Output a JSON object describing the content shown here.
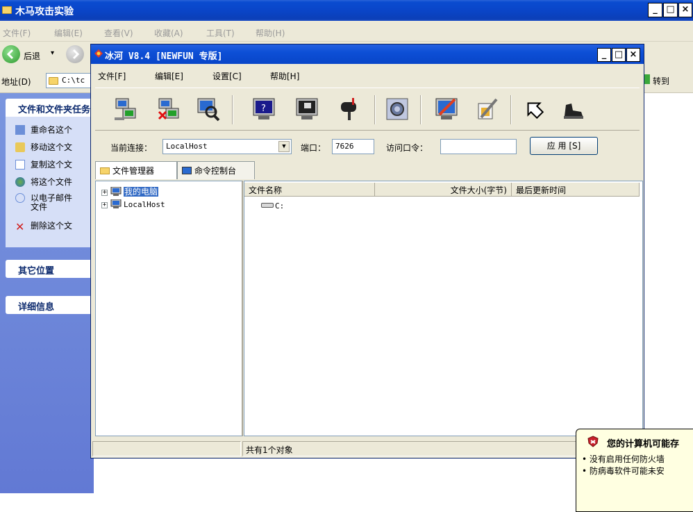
{
  "explorer": {
    "title": "木马攻击实验",
    "menu": [
      "文件(F)",
      "编辑(E)",
      "查看(V)",
      "收藏(A)",
      "工具(T)",
      "帮助(H)"
    ],
    "back_label": "后退",
    "address_label": "地址(D)",
    "address_value": "C:\\tc",
    "go_label": "转到",
    "tasks_header": "文件和文件夹任务",
    "tasks": [
      {
        "label": "重命名这个",
        "icon": "rename-icon"
      },
      {
        "label": "移动这个文",
        "icon": "move-icon"
      },
      {
        "label": "复制这个文",
        "icon": "copy-icon"
      },
      {
        "label": "将这个文件",
        "icon": "publish-icon"
      },
      {
        "label": "以电子邮件",
        "label2": "文件",
        "icon": "email-icon"
      },
      {
        "label": "删除这个文",
        "icon": "delete-icon"
      }
    ],
    "other_places": "其它位置",
    "details": "详细信息"
  },
  "bh": {
    "title": "冰河 V8.4 [NEWFUN 专版]",
    "menu": [
      "文件[F]",
      "编辑[E]",
      "设置[C]",
      "帮助[H]"
    ],
    "toolbar_icons": [
      "connect-icon",
      "disconnect-icon",
      "search-icon",
      "screen-capture-icon",
      "screen-control-icon",
      "mailbox-icon",
      "settings-icon",
      "edit-icon",
      "tools-icon",
      "up-icon",
      "exit-icon"
    ],
    "conn_label": "当前连接：",
    "conn_value": "LocalHost",
    "port_label": "端口：",
    "port_value": "7626",
    "password_label": "访问口令：",
    "password_value": "",
    "apply_label": "应 用 [S]",
    "tabs": [
      "文件管理器",
      "命令控制台"
    ],
    "tree": [
      "我的电脑",
      "LocalHost"
    ],
    "columns": [
      "文件名称",
      "文件大小(字节)",
      "最后更新时间"
    ],
    "files": [
      "C:"
    ],
    "status": "共有1个对象"
  },
  "balloon": {
    "title": "您的计算机可能存",
    "lines": [
      "• 没有启用任何防火墙",
      "• 防病毒软件可能未安"
    ]
  }
}
